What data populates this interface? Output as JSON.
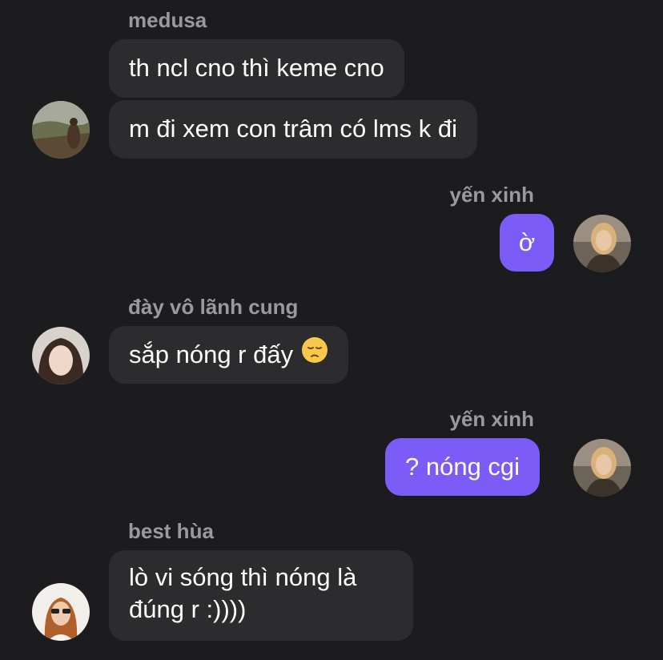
{
  "messages": [
    {
      "sender": "medusa",
      "lines": [
        "th ncl cno thì keme cno",
        "m đi xem con trâm có lms k đi"
      ]
    },
    {
      "sender": "yến xinh",
      "text": "ờ"
    },
    {
      "sender": "đày vô lãnh cung",
      "text": "sắp nóng r đấy",
      "emoji": "pensive-face-icon"
    },
    {
      "sender": "yến xinh",
      "text": "? nóng cgi"
    },
    {
      "sender": "best hùa",
      "text_line1": "lò vi sóng thì nóng là",
      "text_line2": "đúng r :))))"
    }
  ],
  "colors": {
    "background": "#1c1c1e",
    "incoming_bubble": "#2c2c2e",
    "outgoing_bubble": "#7b5cf6",
    "sender_name": "#9a9a9e"
  }
}
